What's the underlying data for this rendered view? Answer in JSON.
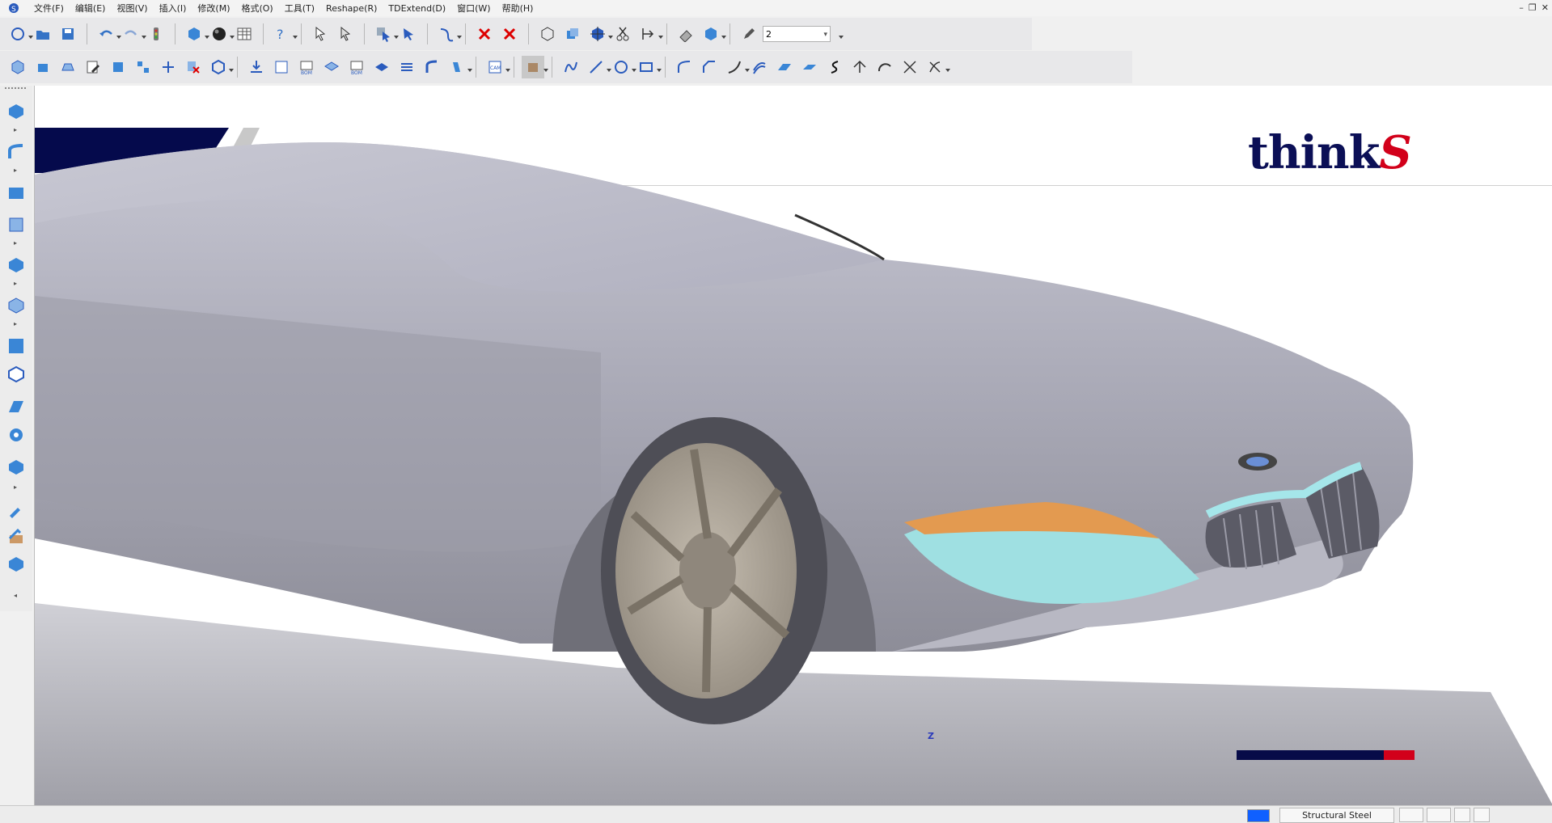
{
  "menubar": {
    "items": [
      "文件(F)",
      "编辑(E)",
      "视图(V)",
      "插入(I)",
      "修改(M)",
      "格式(O)",
      "工具(T)",
      "Reshape(R)",
      "TDExtend(D)",
      "窗口(W)",
      "帮助(H)"
    ]
  },
  "toolbar": {
    "width_combo_value": "2"
  },
  "viewport": {
    "logo_text": "think",
    "logo_mark": "S",
    "triad_z": "Z"
  },
  "statusbar": {
    "material": "Structural Steel"
  },
  "colors": {
    "banner": "#050a4c",
    "logo_accent": "#d2001a",
    "active_color": "#1060ff"
  }
}
